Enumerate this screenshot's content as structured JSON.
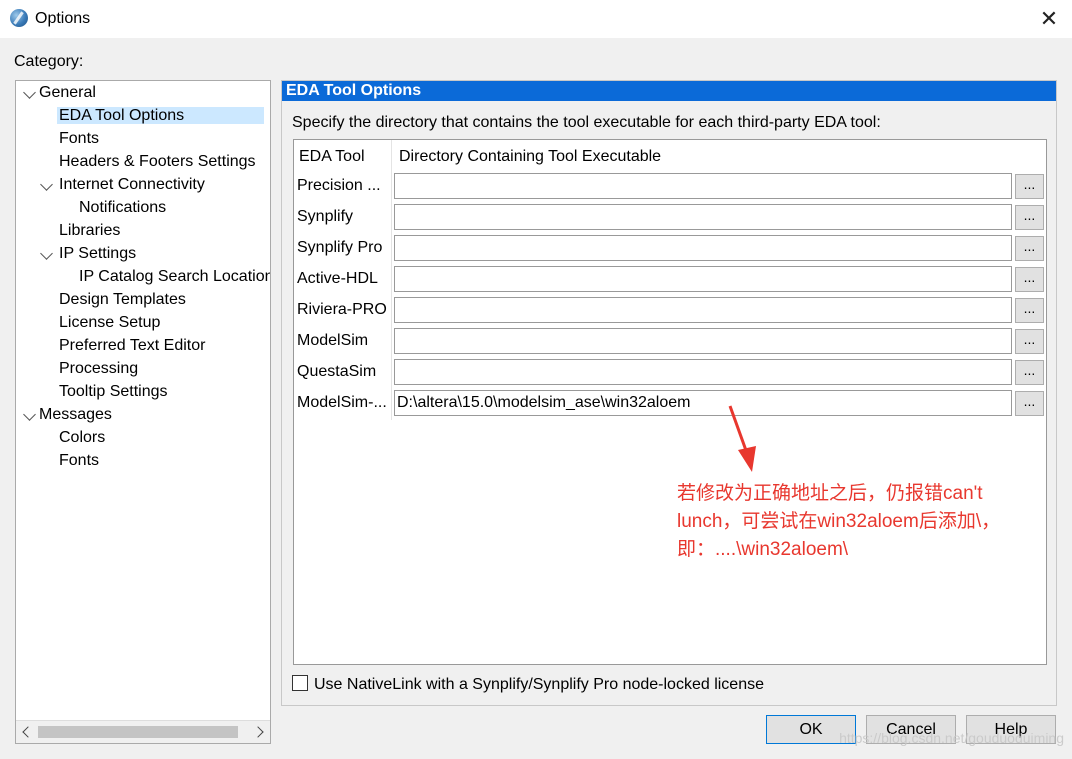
{
  "window": {
    "title": "Options"
  },
  "category_label": "Category:",
  "tree": {
    "items": [
      {
        "label": "General",
        "level": 0,
        "expanded": true
      },
      {
        "label": "EDA Tool Options",
        "level": 1,
        "selected": true
      },
      {
        "label": "Fonts",
        "level": 1
      },
      {
        "label": "Headers & Footers Settings",
        "level": 1
      },
      {
        "label": "Internet Connectivity",
        "level": 1,
        "expanded": true
      },
      {
        "label": "Notifications",
        "level": 2
      },
      {
        "label": "Libraries",
        "level": 1
      },
      {
        "label": "IP Settings",
        "level": 1,
        "expanded": true
      },
      {
        "label": "IP Catalog Search Locations",
        "level": 2
      },
      {
        "label": "Design Templates",
        "level": 1
      },
      {
        "label": "License Setup",
        "level": 1
      },
      {
        "label": "Preferred Text Editor",
        "level": 1
      },
      {
        "label": "Processing",
        "level": 1
      },
      {
        "label": "Tooltip Settings",
        "level": 1
      },
      {
        "label": "Messages",
        "level": 0,
        "expanded": true
      },
      {
        "label": "Colors",
        "level": 1
      },
      {
        "label": "Fonts",
        "level": 1
      }
    ]
  },
  "panel": {
    "header": "EDA Tool Options",
    "description": "Specify the directory that contains the tool executable for each third-party EDA tool:",
    "columns": [
      "EDA Tool",
      "Directory Containing Tool Executable"
    ],
    "browse_label": "...",
    "rows": [
      {
        "tool": "Precision ...",
        "path": ""
      },
      {
        "tool": "Synplify",
        "path": ""
      },
      {
        "tool": "Synplify Pro",
        "path": ""
      },
      {
        "tool": "Active-HDL",
        "path": ""
      },
      {
        "tool": "Riviera-PRO",
        "path": ""
      },
      {
        "tool": "ModelSim",
        "path": ""
      },
      {
        "tool": "QuestaSim",
        "path": ""
      },
      {
        "tool": "ModelSim-...",
        "path": "D:\\altera\\15.0\\modelsim_ase\\win32aloem"
      }
    ],
    "annotation": "若修改为正确地址之后，仍报错can't lunch，可尝试在win32aloem后添加\\，即：....\\win32aloem\\",
    "checkbox_label": "Use NativeLink with a Synplify/Synplify Pro node-locked license"
  },
  "buttons": {
    "ok": "OK",
    "cancel": "Cancel",
    "help": "Help"
  },
  "watermark": "https://blog.csdn.net/gouduoduiming",
  "colors": {
    "header_bg": "#0b6ad8",
    "selection": "#cce8ff",
    "annotation": "#e8372e"
  }
}
